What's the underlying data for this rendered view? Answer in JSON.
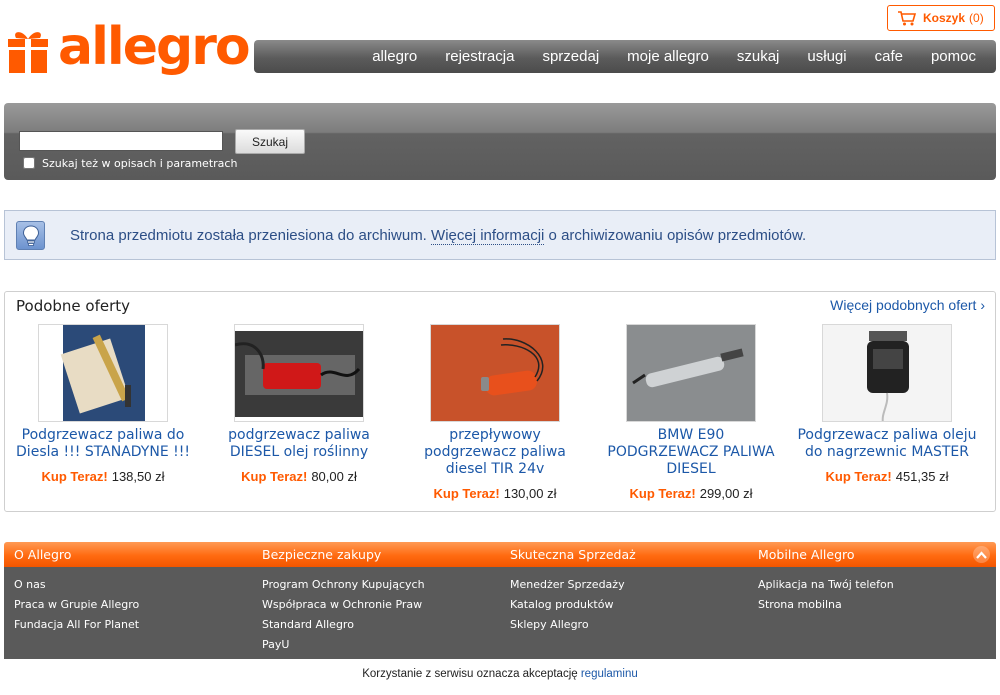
{
  "header": {
    "logo_text": "allegro",
    "cart": {
      "label": "Koszyk",
      "count": "(0)"
    },
    "nav": [
      "allegro",
      "rejestracja",
      "sprzedaj",
      "moje allegro",
      "szukaj",
      "usługi",
      "cafe",
      "pomoc"
    ]
  },
  "search": {
    "input_value": "",
    "button_label": "Szukaj",
    "checkbox_label": "Szukaj też w opisach i parametrach"
  },
  "info": {
    "text_before": "Strona przedmiotu została przeniesiona do archiwum. ",
    "link": "Więcej informacji",
    "text_after": " o archiwizowaniu opisów przedmiotów."
  },
  "similar": {
    "title": "Podobne oferty",
    "more_link": "Więcej podobnych ofert ›",
    "buy_label": "Kup Teraz!",
    "offers": [
      {
        "title": "Podgrzewacz paliwa do Diesla !!! STANADYNE !!!",
        "price": "138,50 zł"
      },
      {
        "title": "podgrzewacz paliwa DIESEL olej roślinny",
        "price": "80,00 zł"
      },
      {
        "title": "przepływowy podgrzewacz paliwa diesel TIR 24v",
        "price": "130,00 zł"
      },
      {
        "title": "BMW E90 PODGRZEWACZ PALIWA DIESEL",
        "price": "299,00 zł"
      },
      {
        "title": "Podgrzewacz paliwa oleju do nagrzewnic MASTER",
        "price": "451,35 zł"
      }
    ]
  },
  "footer": {
    "columns": [
      {
        "heading": "O Allegro",
        "links": [
          "O nas",
          "Praca w Grupie Allegro",
          "Fundacja All For Planet"
        ]
      },
      {
        "heading": "Bezpieczne zakupy",
        "links": [
          "Program Ochrony Kupujących",
          "Współpraca w Ochronie Praw",
          "Standard Allegro",
          "PayU"
        ]
      },
      {
        "heading": "Skuteczna Sprzedaż",
        "links": [
          "Menedżer Sprzedaży",
          "Katalog produktów",
          "Sklepy Allegro"
        ]
      },
      {
        "heading": "Mobilne Allegro",
        "links": [
          "Aplikacja na Twój telefon",
          "Strona mobilna"
        ]
      }
    ],
    "legal_text": "Korzystanie z serwisu oznacza akceptację ",
    "legal_link": "regulaminu"
  },
  "colors": {
    "brand": "#ff5a00",
    "link": "#1c58a8",
    "info_text": "#2c4e86"
  }
}
